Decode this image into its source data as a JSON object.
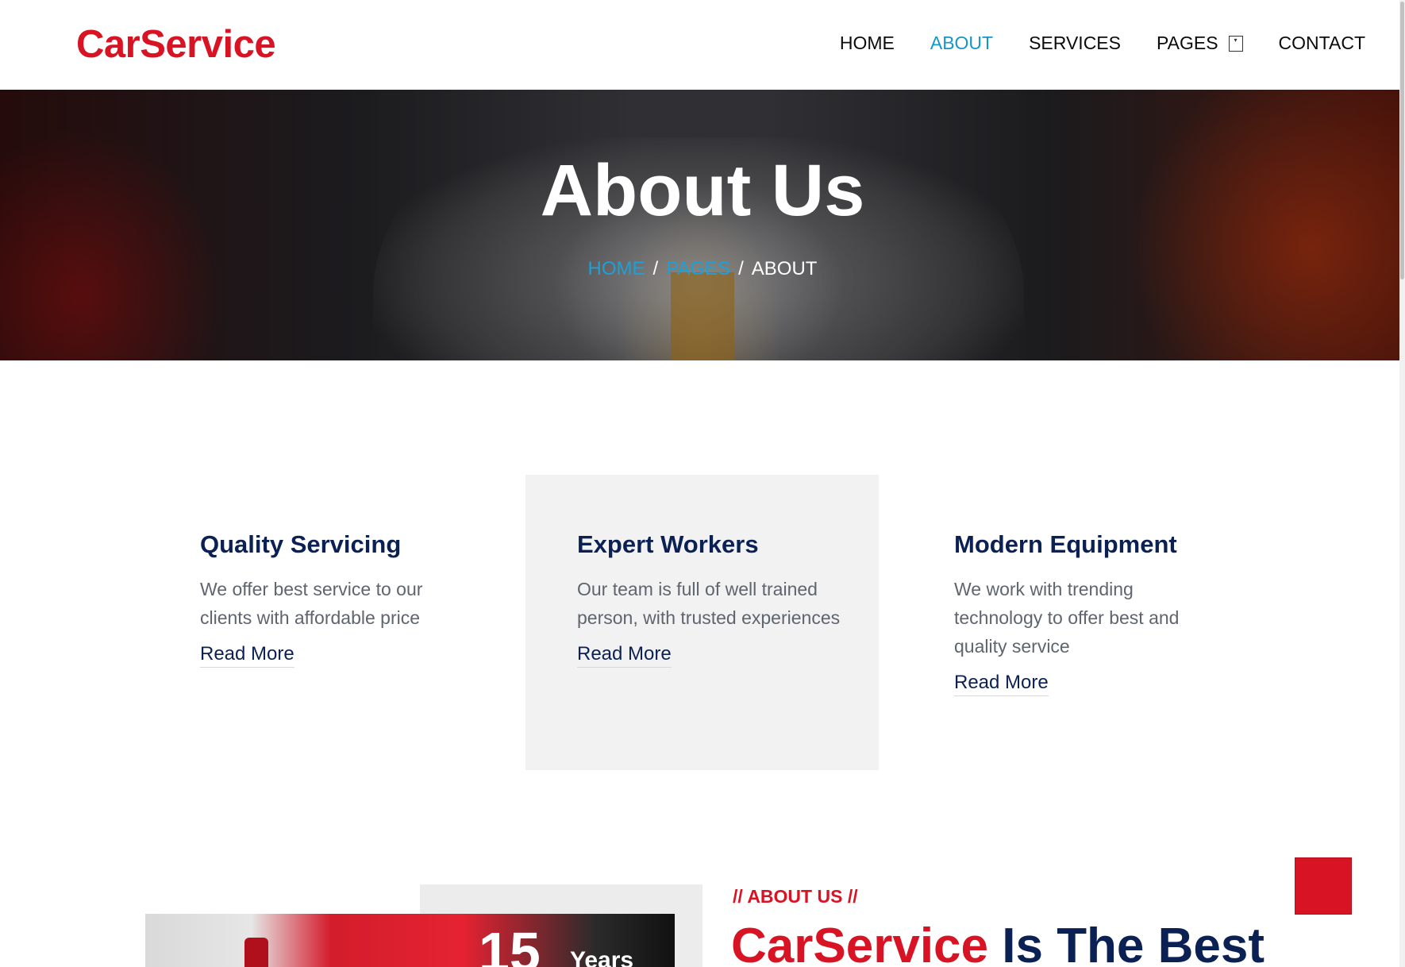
{
  "brand": "CarService",
  "nav": {
    "items": [
      {
        "label": "HOME",
        "active": false
      },
      {
        "label": "ABOUT",
        "active": true
      },
      {
        "label": "SERVICES",
        "active": false
      },
      {
        "label": "PAGES",
        "active": false,
        "dropdown": true
      },
      {
        "label": "CONTACT",
        "active": false
      }
    ],
    "dropdown_icon": "chevron-down-icon"
  },
  "hero": {
    "title": "About Us",
    "breadcrumb": [
      "HOME",
      "PAGES",
      "ABOUT"
    ],
    "separator": "/"
  },
  "features": [
    {
      "title": "Quality Servicing",
      "text": "We offer best service to our clients with affordable price",
      "link": "Read More"
    },
    {
      "title": "Expert Workers",
      "text": "Our team is full of well trained person, with trusted experiences",
      "link": "Read More"
    },
    {
      "title": "Modern Equipment",
      "text": "We work with trending technology to offer best and quality service",
      "link": "Read More"
    }
  ],
  "about": {
    "kicker": "// ABOUT US //",
    "heading_brand": "CarService",
    "heading_rest": " Is The Best",
    "years_number": "15",
    "years_label": "Years"
  },
  "colors": {
    "brand_red": "#d81324",
    "navy": "#0b2154",
    "link_blue": "#1695c9"
  }
}
